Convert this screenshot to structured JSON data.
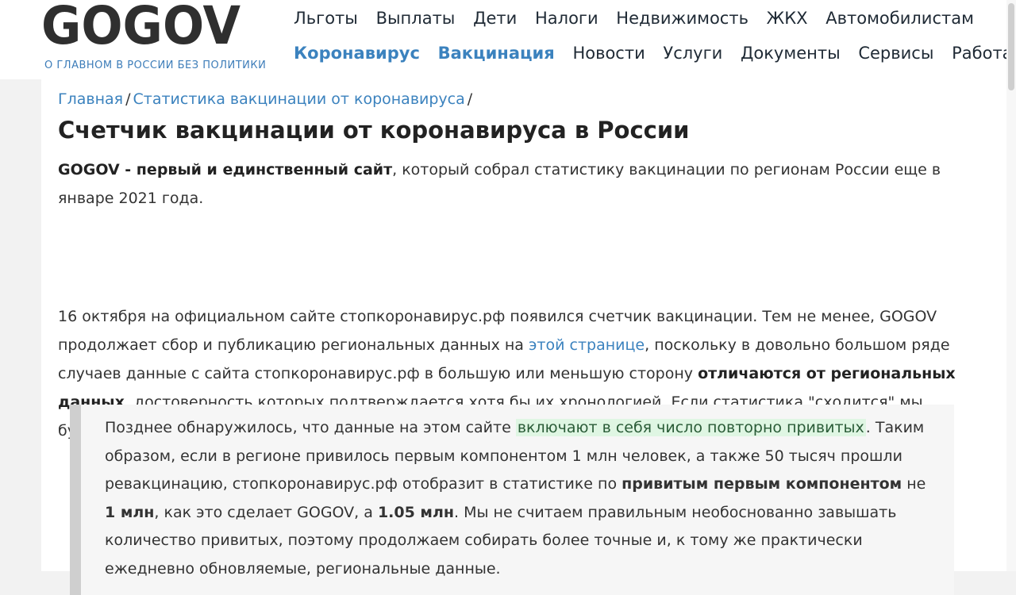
{
  "site": {
    "logo": "GOGOV",
    "tagline": "О ГЛАВНОМ В РОССИИ БЕЗ ПОЛИТИКИ"
  },
  "nav": {
    "row1": [
      {
        "label": "Льготы"
      },
      {
        "label": "Выплаты"
      },
      {
        "label": "Дети"
      },
      {
        "label": "Налоги"
      },
      {
        "label": "Недвижимость"
      },
      {
        "label": "ЖКХ"
      },
      {
        "label": "Автомобилистам"
      }
    ],
    "row2": [
      {
        "label": "Коронавирус",
        "accent": true
      },
      {
        "label": "Вакцинация",
        "accent": true
      },
      {
        "label": "Новости"
      },
      {
        "label": "Услуги"
      },
      {
        "label": "Документы"
      },
      {
        "label": "Сервисы"
      },
      {
        "label": "Работа"
      }
    ]
  },
  "breadcrumb": {
    "items": [
      "Главная",
      "Статистика вакцинации от коронавируса"
    ],
    "separator": "/"
  },
  "page": {
    "title": "Счетчик вакцинации от коронавируса в России"
  },
  "article": {
    "p1": {
      "bold": "GOGOV - первый и единственный сайт",
      "rest": ", который собрал статистику вакцинации по регионам России еще в январе 2021 года."
    },
    "p2": {
      "part1": "16 октября на официальном сайте стопкоронавирус.рф появился счетчик вакцинации. Тем не менее, GOGOV продолжает сбор и публикацию региональных данных на ",
      "link": "этой странице",
      "part2": ", поскольку в довольно большом ряде случаев данные с сайта стопкоронавирус.рф в большую или меньшую сторону ",
      "bold": "отличаются от региональных данных",
      "part3": ", достоверность которых подтверждается хотя бы их хронологией. Если статистика \"сходится\" мы будем использовать федеральные данные, в противном случае отдадим предпочтение региональным."
    },
    "quote": {
      "part1": "Позднее обнаружилось, что данные на этом сайте ",
      "highlight": "включают в себя число повторно привитых",
      "part2": ". Таким образом, если в регионе привилось первым компонентом 1 млн человек, а также 50 тысяч прошли ревакцинацию, стопкоронавирус.рф отобразит в статистике по ",
      "bold1": "привитым первым компонентом",
      "part3": " не ",
      "bold2": "1 млн",
      "part4": ", как это сделает GOGOV, а ",
      "bold3": "1.05 млн",
      "part5": ". Мы не считаем правильным необоснованно завышать количество привитых, поэтому продолжаем собирать более точные и, к тому же практически ежедневно обновляемые, региональные данные."
    }
  }
}
